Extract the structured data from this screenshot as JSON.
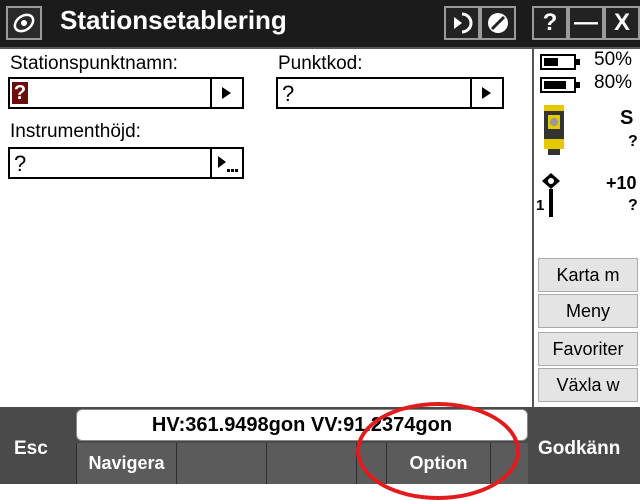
{
  "titlebar": {
    "title": "Stationsetablering",
    "icons": [
      "app-logo-icon",
      "go-to-icon",
      "not-allowed-icon"
    ],
    "help_label": "?",
    "minimize_label": "—",
    "close_label": "X"
  },
  "form": {
    "station_label": "Stationspunktnamn:",
    "station_value": "?",
    "code_label": "Punktkod:",
    "code_value": "?",
    "height_label": "Instrumenthöjd:",
    "height_value": "?"
  },
  "status": {
    "battery1_pct": "50%",
    "battery1_level": 0.5,
    "battery2_pct": "80%",
    "battery2_level": 0.8,
    "instrument_letter": "S",
    "instrument_q": "?",
    "target_value": "+10",
    "target_q": "?",
    "target_num": "1"
  },
  "side_buttons": [
    "Karta m",
    "Meny",
    "Favoriter",
    "Växla w"
  ],
  "bottom": {
    "angles": "HV:361.9498gon VV:91.2374gon",
    "esc_label": "Esc",
    "accept_label": "Godkänn",
    "softkeys": [
      "Navigera",
      "",
      "",
      "",
      "Option",
      ""
    ]
  },
  "colors": {
    "annotation_circle": "#e21c1c"
  }
}
